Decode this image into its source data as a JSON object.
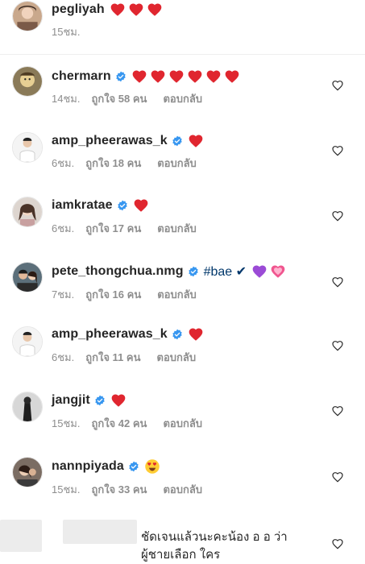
{
  "comments": [
    {
      "username": "pegliyah",
      "verified": false,
      "time": "15ชม.",
      "likes": "",
      "reply": "",
      "text": "",
      "emojis": [
        "heart-red",
        "heart-red",
        "heart-red"
      ]
    },
    {
      "username": "chermarn",
      "verified": true,
      "time": "14ชม.",
      "likes": "ถูกใจ 58 คน",
      "reply": "ตอบกลับ",
      "text": "",
      "emojis": [
        "heart-red",
        "heart-red",
        "heart-red",
        "heart-red",
        "heart-red",
        "heart-red"
      ]
    },
    {
      "username": "amp_pheerawas_k",
      "verified": true,
      "time": "6ชม.",
      "likes": "ถูกใจ 18 คน",
      "reply": "ตอบกลับ",
      "text": "",
      "emojis": [
        "heart-red"
      ]
    },
    {
      "username": "iamkratae",
      "verified": true,
      "time": "6ชม.",
      "likes": "ถูกใจ 17 คน",
      "reply": "ตอบกลับ",
      "text": "",
      "emojis": [
        "heart-red"
      ]
    },
    {
      "username": "pete_thongchua.nmg",
      "verified": true,
      "time": "7ชม.",
      "likes": "ถูกใจ 16 คน",
      "reply": "ตอบกลับ",
      "text": "#bae ✔",
      "emojis": [
        "heart-purple",
        "heart-growing-pink"
      ]
    },
    {
      "username": "amp_pheerawas_k",
      "verified": true,
      "time": "6ชม.",
      "likes": "ถูกใจ 11 คน",
      "reply": "ตอบกลับ",
      "text": "",
      "emojis": [
        "heart-red"
      ]
    },
    {
      "username": "jangjit",
      "verified": true,
      "time": "15ชม.",
      "likes": "ถูกใจ 42 คน",
      "reply": "ตอบกลับ",
      "text": "",
      "emojis": [
        "heart-red"
      ]
    },
    {
      "username": "nannpiyada",
      "verified": true,
      "time": "15ชม.",
      "likes": "ถูกใจ 33 คน",
      "reply": "ตอบกลับ",
      "text": "",
      "emojis": [
        "heart-eyes-face"
      ]
    }
  ],
  "last_comment": {
    "line1": "ชัดเจนแล้วนะคะน้อง อ อ ว่า",
    "line2": "ผู้ชายเลือก ใคร"
  },
  "colors": {
    "username": "#262626",
    "meta": "#8e8e8e",
    "verified_blue": "#3897f0",
    "heart_red": "#e0262f",
    "heart_purple": "#9b4bd6",
    "heart_pink": "#f0568f",
    "hashtag": "#00376b"
  },
  "icons": {
    "like": "heart-outline-icon",
    "verified": "verified-badge-icon"
  }
}
